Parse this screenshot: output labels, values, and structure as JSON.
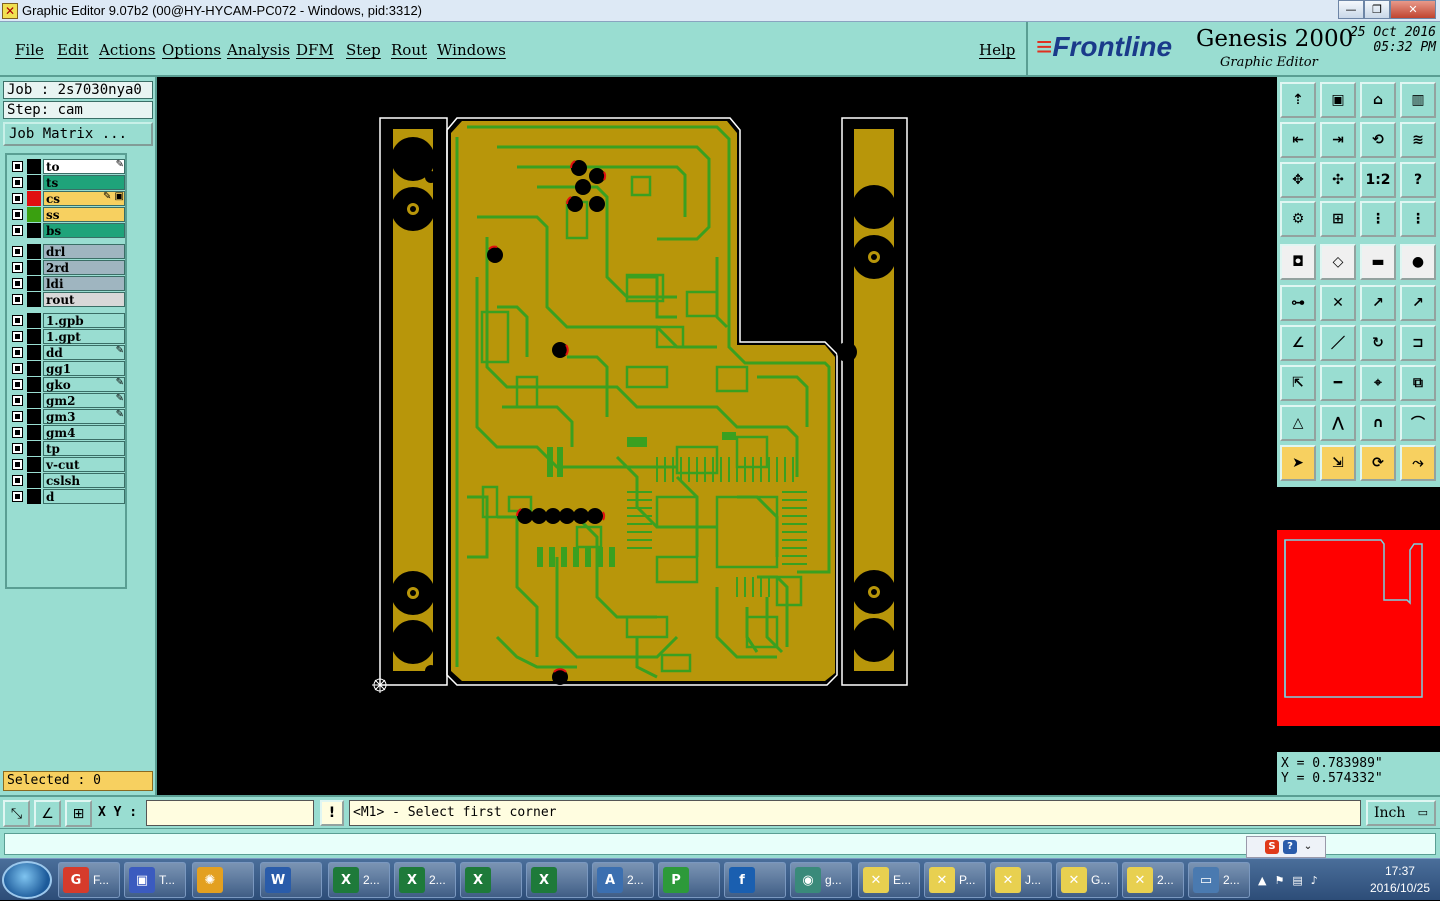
{
  "window": {
    "title": "Graphic Editor 9.07b2 (00@HY-HYCAM-PC072 - Windows, pid:3312)",
    "minimize": "—",
    "restore": "❐",
    "close": "✕"
  },
  "menu": {
    "items": [
      "File",
      "Edit",
      "Actions",
      "Options",
      "Analysis",
      "DFM",
      "Step",
      "Rout",
      "Windows"
    ],
    "help": "Help"
  },
  "brand": {
    "logo": "Frontline",
    "product": "Genesis 2000",
    "subtitle": "Graphic Editor",
    "date": "25 Oct 2016",
    "time": "05:32 PM"
  },
  "job": {
    "job_label": "Job : 2s7030nya0",
    "step_label": "Step: cam",
    "matrix_button": "Job Matrix ..."
  },
  "layers": [
    {
      "name": "to",
      "bg": "#ffffff",
      "swatch": "#000000",
      "flag": "✎"
    },
    {
      "name": "ts",
      "bg": "#1fa37a",
      "swatch": "#000000",
      "flag": ""
    },
    {
      "name": "cs",
      "bg": "#f7d060",
      "swatch": "#e01010",
      "flag": "✎ ▣",
      "selected": true
    },
    {
      "name": "ss",
      "bg": "#f7d060",
      "swatch": "#3aa010",
      "flag": ""
    },
    {
      "name": "bs",
      "bg": "#1fa37a",
      "swatch": "#000000",
      "flag": ""
    },
    {
      "name": "drl",
      "bg": "#9fb5c0",
      "swatch": "#000000",
      "flag": ""
    },
    {
      "name": "2rd",
      "bg": "#9fb5c0",
      "swatch": "#000000",
      "flag": ""
    },
    {
      "name": "ldi",
      "bg": "#9fb5c0",
      "swatch": "#000000",
      "flag": ""
    },
    {
      "name": "rout",
      "bg": "#d8d8d8",
      "swatch": "#000000",
      "flag": ""
    },
    {
      "name": "1.gpb",
      "bg": "#99ddd1",
      "swatch": "#000000",
      "flag": ""
    },
    {
      "name": "1.gpt",
      "bg": "#99ddd1",
      "swatch": "#000000",
      "flag": ""
    },
    {
      "name": "dd",
      "bg": "#99ddd1",
      "swatch": "#000000",
      "flag": "✎"
    },
    {
      "name": "gg1",
      "bg": "#99ddd1",
      "swatch": "#000000",
      "flag": ""
    },
    {
      "name": "gko",
      "bg": "#99ddd1",
      "swatch": "#000000",
      "flag": "✎"
    },
    {
      "name": "gm2",
      "bg": "#99ddd1",
      "swatch": "#000000",
      "flag": "✎"
    },
    {
      "name": "gm3",
      "bg": "#99ddd1",
      "swatch": "#000000",
      "flag": "✎"
    },
    {
      "name": "gm4",
      "bg": "#99ddd1",
      "swatch": "#000000",
      "flag": ""
    },
    {
      "name": "tp",
      "bg": "#99ddd1",
      "swatch": "#000000",
      "flag": ""
    },
    {
      "name": "v-cut",
      "bg": "#99ddd1",
      "swatch": "#000000",
      "flag": ""
    },
    {
      "name": "cslsh",
      "bg": "#99ddd1",
      "swatch": "#000000",
      "flag": ""
    },
    {
      "name": "d",
      "bg": "#99ddd1",
      "swatch": "#000000",
      "flag": ""
    }
  ],
  "selected": "Selected : 0",
  "coords": {
    "x": "X = 0.783989\"",
    "y": "Y = 0.574332\""
  },
  "command": {
    "xy_label": "X Y :",
    "xy_value": "",
    "excl": "!",
    "prompt": "<M1> - Select first corner",
    "unit": "Inch"
  },
  "toolbar_icons": [
    "zoom-home-icon",
    "zoom-in-icon",
    "zoom-out-icon",
    "zoom-area-icon",
    "pan-icon",
    "zoom-fit-icon",
    "mirror-icon",
    "undo-icon",
    "center-icon",
    "zoom-extents-icon",
    "scale-1-2-icon",
    "help-icon",
    "measure-icon",
    "grid-icon",
    "snap-icon",
    "snap-off-icon",
    "shape-icon",
    "diamond-icon",
    "ruler-icon",
    "pad-icon",
    "net-icon",
    "cross-icon",
    "line-snap-icon",
    "arc-snap-icon",
    "angle-icon",
    "slope-icon",
    "arc-icon",
    "flip-icon",
    "move-icon",
    "line-icon",
    "dimension-icon",
    "copy-icon",
    "triangle-icon",
    "peak-icon",
    "arch-icon",
    "bridge-icon",
    "select-icon",
    "select-box-icon",
    "select-round-icon",
    "select-net-icon"
  ],
  "toolbar_labels": [
    "",
    "",
    "",
    "",
    "",
    "",
    "",
    "",
    "",
    "",
    "1:2",
    "?"
  ],
  "taskbar": {
    "items": [
      {
        "label": "F...",
        "color": "#d63b2b",
        "icon": "G"
      },
      {
        "label": "T...",
        "color": "#3b5bbf",
        "icon": "▣"
      },
      {
        "label": "",
        "color": "#e3a020",
        "icon": "✺"
      },
      {
        "label": "",
        "color": "#2a5caa",
        "icon": "W"
      },
      {
        "label": "2...",
        "color": "#1e7a3a",
        "icon": "X"
      },
      {
        "label": "2...",
        "color": "#1e7a3a",
        "icon": "X"
      },
      {
        "label": "",
        "color": "#1e7a3a",
        "icon": "X"
      },
      {
        "label": "",
        "color": "#1e7a3a",
        "icon": "X"
      },
      {
        "label": "2...",
        "color": "#3b6fb0",
        "icon": "A"
      },
      {
        "label": "",
        "color": "#2d9a3a",
        "icon": "P"
      },
      {
        "label": "",
        "color": "#1a5fb0",
        "icon": "f"
      },
      {
        "label": "g...",
        "color": "#3a8a7a",
        "icon": "◉"
      },
      {
        "label": "E...",
        "color": "#e8d050",
        "icon": "✕"
      },
      {
        "label": "P...",
        "color": "#e8d050",
        "icon": "✕"
      },
      {
        "label": "J...",
        "color": "#e8d050",
        "icon": "✕"
      },
      {
        "label": "G...",
        "color": "#e8d050",
        "icon": "✕"
      },
      {
        "label": "2...",
        "color": "#e8d050",
        "icon": "✕"
      },
      {
        "label": "2...",
        "color": "#4a7ab0",
        "icon": "▭"
      }
    ],
    "time": "17:37",
    "date": "2016/10/25"
  },
  "colors": {
    "panel": "#99ddd1",
    "board": "#b8960a",
    "trace": "#3aa020",
    "pad": "#000000",
    "preview": "#ff0000"
  }
}
